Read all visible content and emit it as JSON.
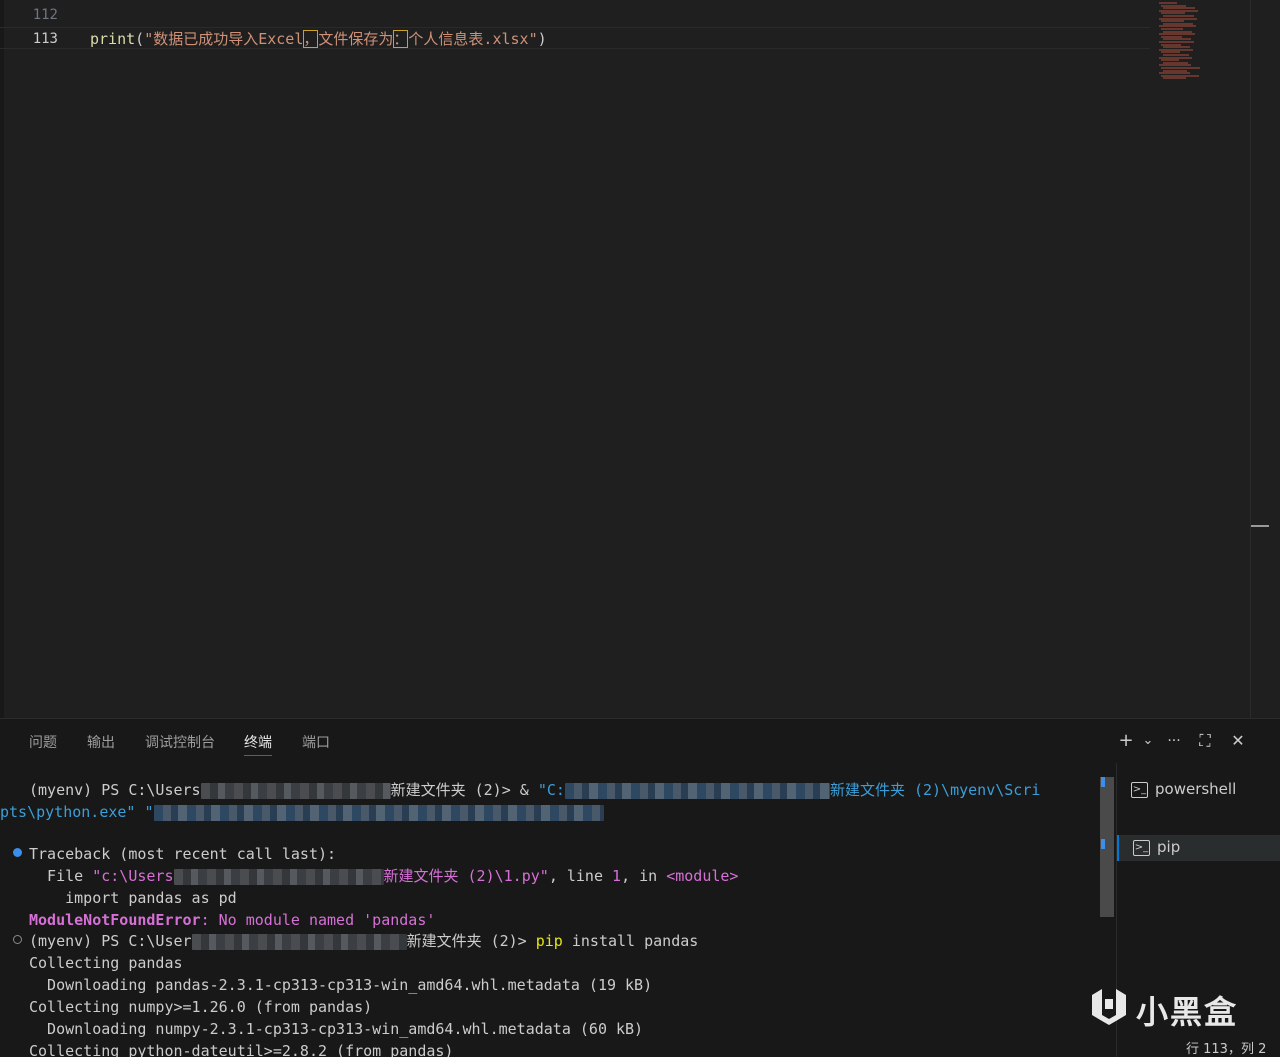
{
  "editor": {
    "lines": [
      {
        "number": "112",
        "text": ""
      },
      {
        "number": "113",
        "fn": "print",
        "open": "(",
        "str_a": "\"数据已成功导入Excel",
        "comma": "，",
        "str_b": "文件保存为",
        "colon": "：",
        "str_c": "个人信息表.xlsx\"",
        "close": ")"
      }
    ]
  },
  "panel": {
    "tabs": [
      "问题",
      "输出",
      "调试控制台",
      "终端",
      "端口"
    ],
    "active_tab": "终端",
    "actions": {
      "add": "+",
      "dropdown": "⌄",
      "more": "···",
      "maximize": "⛶",
      "close": "✕"
    }
  },
  "terminal": {
    "l1_env": "(myenv) PS C:\\Users",
    "l1_mid": "新建文件夹 (2)> & ",
    "l1_q": "\"C:",
    "l1_end": "新建文件夹 (2)\\myenv\\Scri",
    "l2_a": "pts\\python.exe\" ",
    "l2_q": "\"",
    "l3": "Traceback (most recent call last):",
    "l4_a": "  File ",
    "l4_path": "\"c:\\Users",
    "l4_path_end": "新建文件夹 (2)\\1.py\"",
    "l4_b": ", line ",
    "l4_num": "1",
    "l4_c": ", in ",
    "l4_mod": "<module>",
    "l5": "    import pandas as pd",
    "l6_err": "ModuleNotFoundError",
    "l6_msg": ": No module named 'pandas'",
    "l7_env": "(myenv) PS C:\\User",
    "l7_mid": "新建文件夹 (2)> ",
    "l7_cmd": "pip",
    "l7_args": " install pandas",
    "l8": "Collecting pandas",
    "l9": "  Downloading pandas-2.3.1-cp313-cp313-win_amd64.whl.metadata (19 kB)",
    "l10": "Collecting numpy>=1.26.0 (from pandas)",
    "l11": "  Downloading numpy-2.3.1-cp313-cp313-win_amd64.whl.metadata (60 kB)",
    "l12": "Collecting python-dateutil>=2.8.2 (from pandas)"
  },
  "terminal_list": [
    {
      "label": "powershell",
      "selected": false
    },
    {
      "label": "pip",
      "selected": true
    }
  ],
  "terminal_icon_glyph": ">_",
  "watermark": "小黑盒",
  "status_bar": {
    "position": "行 113，列 2"
  },
  "colors": {
    "background": "#1f1f1f",
    "accent": "#0078d4",
    "string": "#ce9178",
    "function": "#dcdcaa"
  }
}
